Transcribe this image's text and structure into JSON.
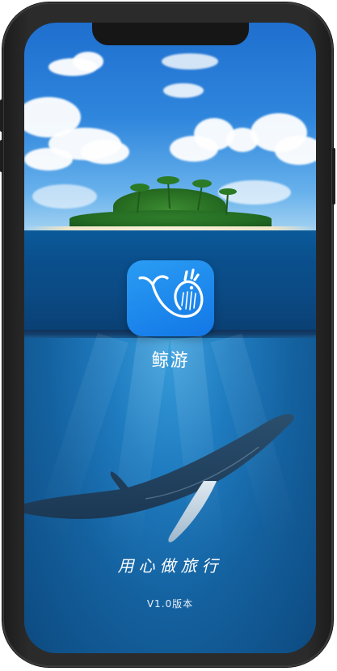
{
  "app": {
    "name": "鲸游",
    "slogan": "用心做旅行",
    "version": "V1.0版本"
  },
  "icons": {
    "app_icon": "whale-app-icon"
  },
  "colors": {
    "icon_gradient_top": "#2a9df4",
    "icon_gradient_bottom": "#1377e6",
    "text": "#ffffff"
  }
}
